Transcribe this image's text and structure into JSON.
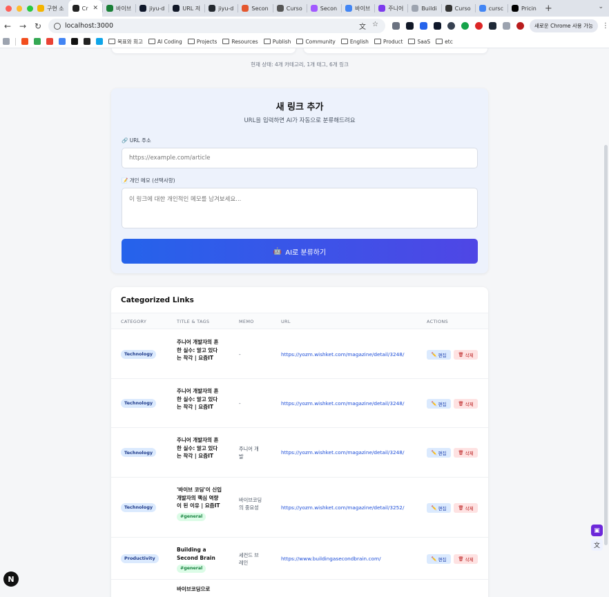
{
  "browser": {
    "tabs": [
      {
        "label": "구현 소",
        "color": "#f4b400",
        "active": false
      },
      {
        "label": "Cr",
        "color": "#222222",
        "active": true
      },
      {
        "label": "바이브",
        "color": "#1a7f37",
        "active": false
      },
      {
        "label": "jiyu-d",
        "color": "#0f172a",
        "active": false
      },
      {
        "label": "URL 저",
        "color": "#111827",
        "active": false
      },
      {
        "label": "jiyu-d",
        "color": "#24292f",
        "active": false
      },
      {
        "label": "Secon",
        "color": "#e4572e",
        "active": false
      },
      {
        "label": "Curso",
        "color": "#555555",
        "active": false
      },
      {
        "label": "Secon",
        "color": "#a259ff",
        "active": false
      },
      {
        "label": "바이브",
        "color": "#4285f4",
        "active": false
      },
      {
        "label": "주니어",
        "color": "#7c3aed",
        "active": false
      },
      {
        "label": "Buildi",
        "color": "#9ca3af",
        "active": false
      },
      {
        "label": "Curso",
        "color": "#333333",
        "active": false
      },
      {
        "label": "cursc",
        "color": "#4285f4",
        "active": false
      },
      {
        "label": "Pricin",
        "color": "#000000",
        "active": false
      }
    ],
    "new_tab": "+",
    "url": "localhost:3000",
    "chrome_notice": "새로운 Chrome 사용 가능",
    "bookmarks": [
      "목표와 회고",
      "AI Coding",
      "Projects",
      "Resources",
      "Publish",
      "Community",
      "English",
      "Product",
      "SaaS",
      "etc"
    ]
  },
  "status": "현재 상태: 4개 카테고리, 1개 태그, 6개 링크",
  "add_form": {
    "title": "새 링크 추가",
    "subtitle": "URL을 입력하면 AI가 자동으로 분류해드려요",
    "url_label": "🔗 URL 주소",
    "url_placeholder": "https://example.com/article",
    "memo_label": "📝 개인 메모 (선택사항)",
    "memo_placeholder": "이 링크에 대한 개인적인 메모를 남겨보세요...",
    "submit_label": "AI로 분류하기"
  },
  "links": {
    "title": "Categorized Links",
    "columns": [
      "CATEGORY",
      "TITLE & TAGS",
      "MEMO",
      "URL",
      "ACTIONS"
    ],
    "edit_label": "편집",
    "delete_label": "삭제",
    "rows": [
      {
        "category": "Technology",
        "title": "주니어 개발자의 흔한 실수: 알고 있다는 착각 | 요즘IT",
        "tag": "",
        "memo": "-",
        "url": "https://yozm.wishket.com/magazine/detail/3248/"
      },
      {
        "category": "Technology",
        "title": "주니어 개발자의 흔한 실수: 알고 있다는 착각 | 요즘IT",
        "tag": "",
        "memo": "-",
        "url": "https://yozm.wishket.com/magazine/detail/3248/"
      },
      {
        "category": "Technology",
        "title": "주니어 개발자의 흔한 실수: 알고 있다는 착각 | 요즘IT",
        "tag": "",
        "memo": "주니어 개발",
        "url": "https://yozm.wishket.com/magazine/detail/3248/"
      },
      {
        "category": "Technology",
        "title": "'바이브 코딩'이 신입 개발자의 핵심 역량이 된 이유 | 요즘IT",
        "tag": "#general",
        "memo": "바이브코딩의 중요성",
        "url": "https://yozm.wishket.com/magazine/detail/3252/"
      },
      {
        "category": "Productivity",
        "title": "Building a Second Brain",
        "tag": "#general",
        "memo": "세컨드 브레인",
        "url": "https://www.buildingasecondbrain.com/"
      },
      {
        "category": "",
        "title": "바이브코딩으로",
        "tag": "",
        "memo": "",
        "url": ""
      }
    ]
  },
  "dev_indicator": "N"
}
